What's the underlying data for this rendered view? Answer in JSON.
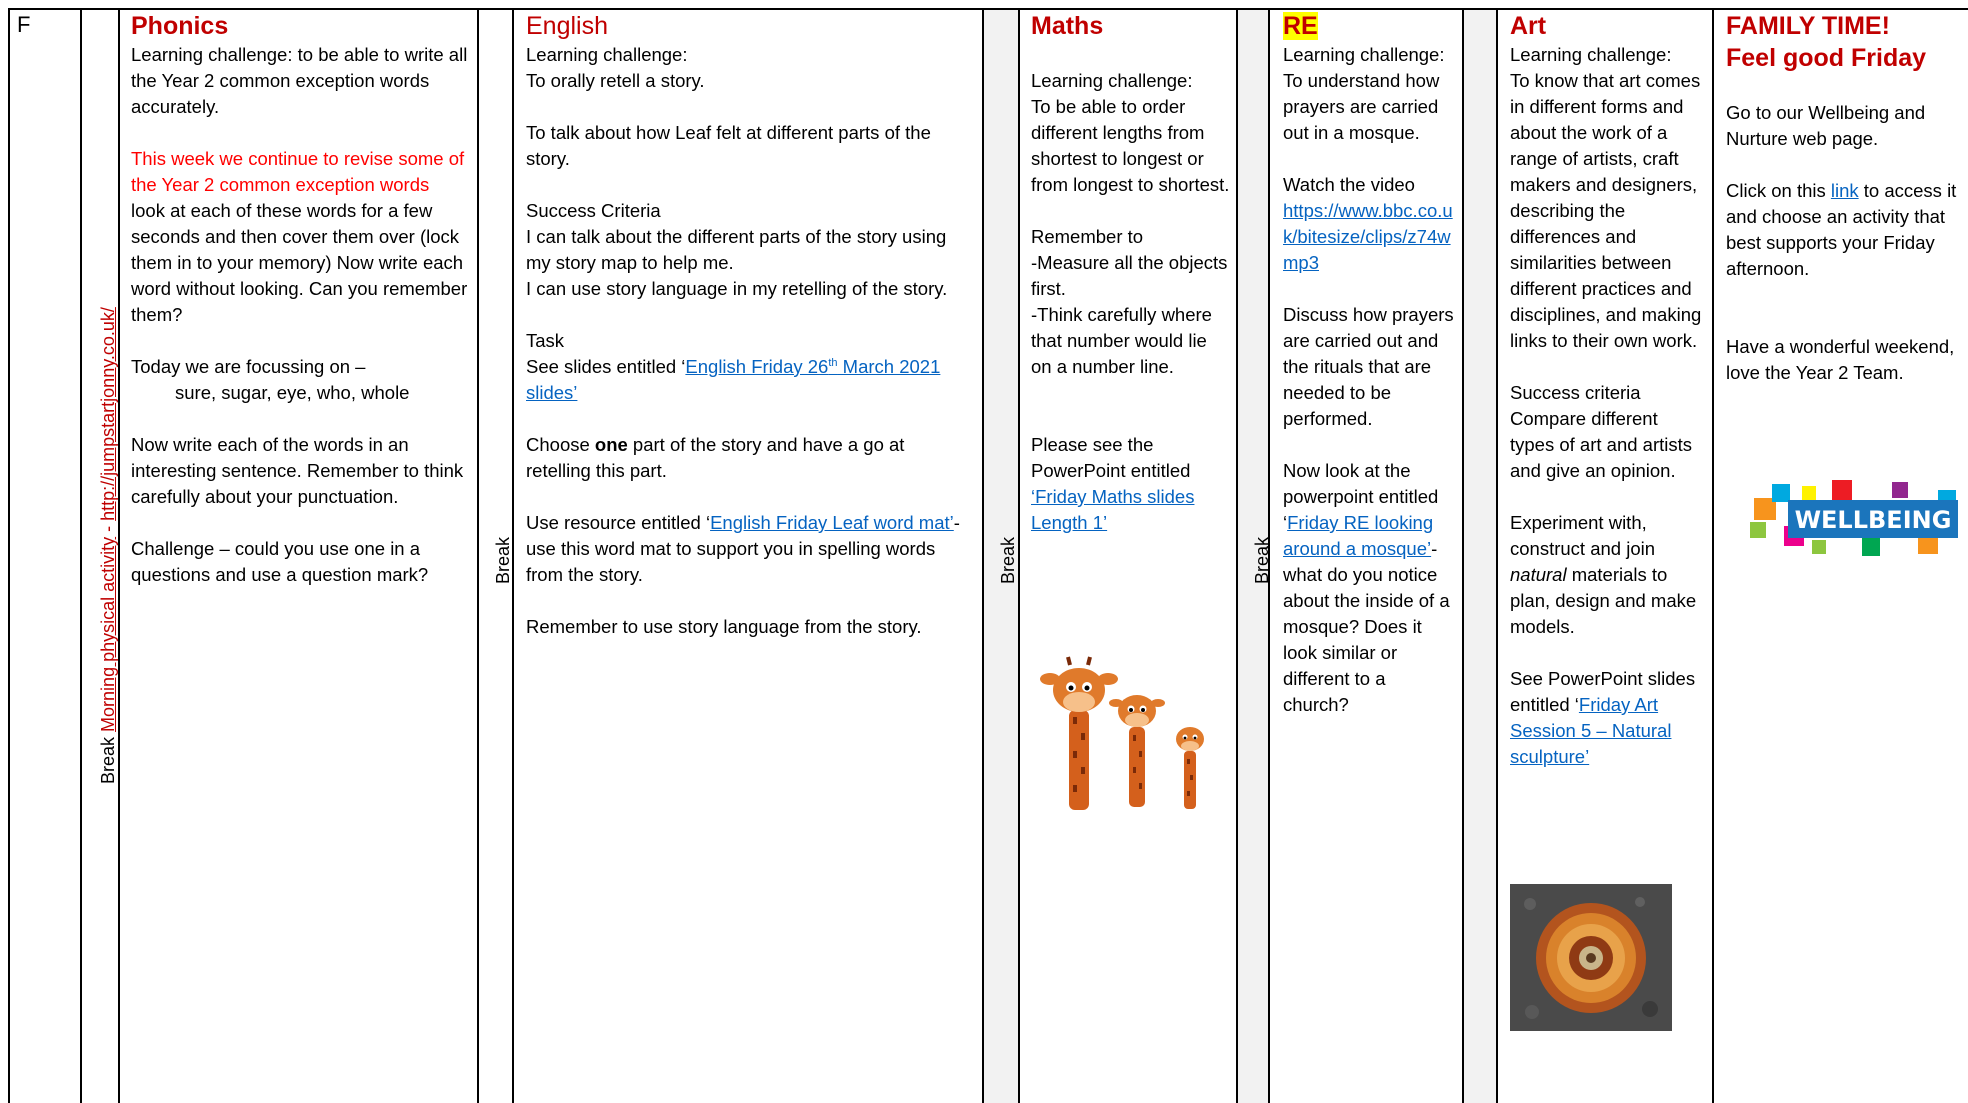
{
  "row_label": "F",
  "break_label": "Break",
  "physical": {
    "label": "Morning physical activity",
    "dash": " - ",
    "url": "http://jumpstartjonny.co.uk/"
  },
  "phonics": {
    "title": "Phonics",
    "challenge": "Learning challenge:  to be able to write all the Year 2 common exception words accurately.",
    "revise": "This week we continue to revise some of the Year 2 common exception words",
    "instructions": "look at each of these words for a few seconds and then cover them over (lock them in to your memory) Now write each word without looking. Can you remember them?",
    "focus_intro": "Today we are focussing on –",
    "words": "sure, sugar, eye, who, whole",
    "sentence": "Now write each of the words in an interesting sentence. Remember to think carefully about your punctuation.",
    "extension": "Challenge – could you use one in a questions and use a question mark?"
  },
  "english": {
    "title": "English",
    "challenge_label": "Learning challenge:",
    "challenge_1": "To orally retell a story.",
    "challenge_2": "To talk about how Leaf felt at different parts of the story.",
    "success_label": "Success Criteria",
    "success_1": "I can talk about the different parts of the story using my story map to help me.",
    "success_2": "I can use story language in my retelling of the story.",
    "task_label": "Task",
    "see_prefix": "See slides entitled ‘",
    "see_link_a": "English Friday 26",
    "see_link_sup": "th",
    "see_link_b": " March 2021 slides’",
    "choose_a": "Choose ",
    "choose_bold": "one",
    "choose_b": " part of the story and have a go at retelling this part.",
    "resource_prefix": "Use resource entitled ‘",
    "resource_link": "English Friday Leaf word mat’",
    "resource_suffix": "- use this word mat to support you in spelling words from the story.",
    "remember": "Remember to use story language from the story."
  },
  "maths": {
    "title": "Maths",
    "challenge_label": "Learning challenge:",
    "challenge": "To be able to order different lengths from shortest to longest or from longest to shortest.",
    "remember_label": "Remember to",
    "remember_1": "-Measure all the objects first.",
    "remember_2": "-Think carefully where that number would lie on a number line.",
    "see": "Please see the PowerPoint entitled",
    "link": "‘Friday Maths slides Length 1’"
  },
  "re": {
    "title": "RE",
    "challenge_label": "Learning challenge:",
    "challenge": "To understand how prayers are carried out in a mosque.",
    "video_label": "Watch the video",
    "video_link": "https://www.bbc.co.uk/bitesize/clips/z74wmp3",
    "discuss": "Discuss how prayers are carried out and the rituals that are needed to be performed.",
    "ppt_prefix": "Now look at the powerpoint entitled ‘",
    "ppt_link": "Friday RE looking around a mosque’",
    "ppt_suffix": "- what do you notice about the inside of a mosque? Does it look similar or different to a church?"
  },
  "art": {
    "title": "Art",
    "challenge_label": "Learning challenge:",
    "challenge": "To know that art comes in different forms and about the work of a range of artists, craft makers and designers, describing the differences and similarities between different practices and disciplines, and making links to their own work.",
    "success_label": "Success criteria",
    "success": "Compare different types of art and artists and give an opinion.",
    "experiment_a": "Experiment with, construct and join ",
    "experiment_italic": "natural",
    "experiment_b": " materials to plan, design and make models.",
    "see_prefix": "See PowerPoint slides entitled ‘",
    "see_link": "Friday Art Session 5 – Natural sculpture’"
  },
  "family": {
    "title_1": "FAMILY TIME!",
    "title_2": "Feel good Friday",
    "go": "Go to our Wellbeing and Nurture web page.",
    "click_prefix": "Click on this ",
    "click_link": "link",
    "click_suffix": " to access it and choose an activity that best supports your Friday afternoon.",
    "farewell": "Have a wonderful weekend, love the Year 2 Team.",
    "logo_text": "WELLBEING"
  }
}
